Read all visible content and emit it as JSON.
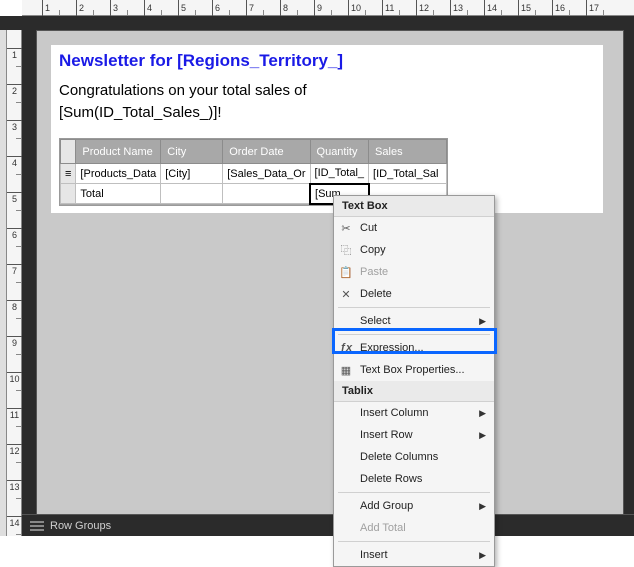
{
  "ruler": {
    "h": [
      "1",
      "2",
      "3",
      "4",
      "5",
      "6",
      "7",
      "8",
      "9",
      "10",
      "11",
      "12",
      "13",
      "14",
      "15",
      "16",
      "17"
    ],
    "v": [
      "1",
      "2",
      "3",
      "4",
      "5",
      "6",
      "7",
      "8",
      "9",
      "10",
      "11",
      "12",
      "13",
      "14"
    ]
  },
  "report": {
    "title": "Newsletter for [Regions_Territory_]",
    "body_line1": "Congratulations on your total sales of",
    "body_line2": "[Sum(ID_Total_Sales_)]!",
    "table": {
      "headers": [
        "Product Name",
        "City",
        "Order Date",
        "Quantity",
        "Sales"
      ],
      "data_row": [
        "[Products_Data",
        "[City]",
        "[Sales_Data_Or",
        "[ID_Total_",
        "[ID_Total_Sal"
      ],
      "total_row_label": "Total",
      "total_row_sum": "[Sum"
    }
  },
  "context_menu": {
    "header1": "Text Box",
    "cut": "Cut",
    "copy": "Copy",
    "paste": "Paste",
    "delete": "Delete",
    "select": "Select",
    "expression": "Expression...",
    "tbprops": "Text Box Properties...",
    "header2": "Tablix",
    "ins_col": "Insert Column",
    "ins_row": "Insert Row",
    "del_cols": "Delete Columns",
    "del_rows": "Delete Rows",
    "add_group": "Add Group",
    "add_total": "Add Total",
    "insert": "Insert"
  },
  "icons": {
    "cut": "✂",
    "copy": "⿻",
    "paste": "📋",
    "delete": "✕",
    "fx": "ƒx",
    "props": "▦"
  },
  "bottom_bar": {
    "row_groups": "Row Groups"
  }
}
